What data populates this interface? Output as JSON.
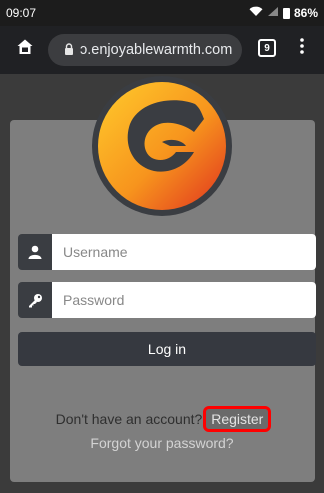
{
  "status_bar": {
    "time": "09:07",
    "battery": "86%"
  },
  "browser": {
    "url": "ɔ.enjoyablewarmth.com",
    "tab_count": "9"
  },
  "login": {
    "username_placeholder": "Username",
    "password_placeholder": "Password",
    "login_label": "Log in",
    "register_prompt": "Don't have an account?",
    "register_label": "Register",
    "forgot_label": "Forgot your password?"
  },
  "colors": {
    "card_bg": "#7e7e7e",
    "addon_bg": "#3a3d42",
    "button_bg": "#363940",
    "logo_orange": "#f7941d",
    "logo_dark": "#3a3d42",
    "highlight": "#ff0000"
  },
  "icons": {
    "home": "home-icon",
    "lock": "lock-icon",
    "tabs": "tabs-icon",
    "menu": "more-vert-icon",
    "user": "user-icon",
    "key": "key-icon",
    "wifi": "wifi-icon",
    "signal": "signal-icon",
    "battery": "battery-icon",
    "logo": "enjoyable-warmth-logo"
  }
}
